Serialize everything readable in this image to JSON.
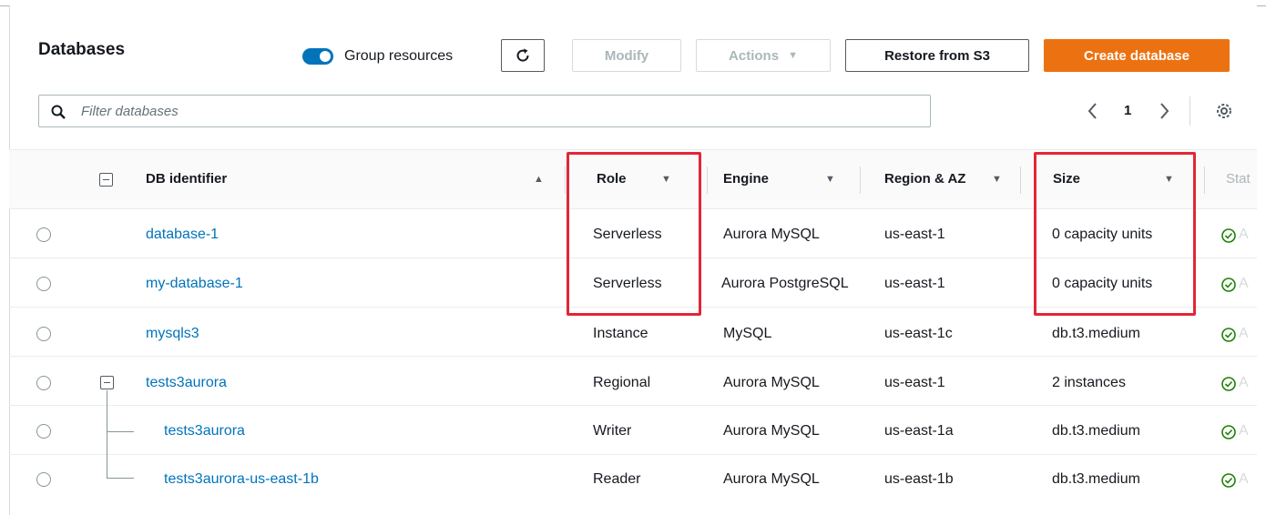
{
  "header": {
    "title": "Databases",
    "group_resources_label": "Group resources",
    "group_resources_on": true,
    "modify_label": "Modify",
    "actions_label": "Actions",
    "restore_label": "Restore from S3",
    "create_label": "Create database"
  },
  "filter": {
    "placeholder": "Filter databases"
  },
  "pagination": {
    "current_page": "1"
  },
  "columns": {
    "db_identifier": "DB identifier",
    "role": "Role",
    "engine": "Engine",
    "region": "Region & AZ",
    "size": "Size",
    "status": "Stat"
  },
  "rows": [
    {
      "id": "database-1",
      "role": "Serverless",
      "engine": "Aurora MySQL",
      "region": "us-east-1",
      "size": "0 capacity units"
    },
    {
      "id": "my-database-1",
      "role": "Serverless",
      "engine": "Aurora PostgreSQL",
      "region": "us-east-1",
      "size": "0 capacity units"
    },
    {
      "id": "mysqls3",
      "role": "Instance",
      "engine": "MySQL",
      "region": "us-east-1c",
      "size": "db.t3.medium"
    },
    {
      "id": "tests3aurora",
      "role": "Regional",
      "engine": "Aurora MySQL",
      "region": "us-east-1",
      "size": "2 instances"
    },
    {
      "id": "tests3aurora",
      "role": "Writer",
      "engine": "Aurora MySQL",
      "region": "us-east-1a",
      "size": "db.t3.medium"
    },
    {
      "id": "tests3aurora-us-east-1b",
      "role": "Reader",
      "engine": "Aurora MySQL",
      "region": "us-east-1b",
      "size": "db.t3.medium"
    }
  ],
  "status_fragment": "A",
  "colors": {
    "link": "#0073bb",
    "primary": "#ec7211",
    "toggle": "#0073bb",
    "highlight": "#e32636",
    "status_ok": "#1d8102"
  },
  "icons": {
    "refresh": "refresh-icon",
    "search": "search-icon",
    "settings": "gear-icon",
    "status": "check-circle-icon"
  }
}
